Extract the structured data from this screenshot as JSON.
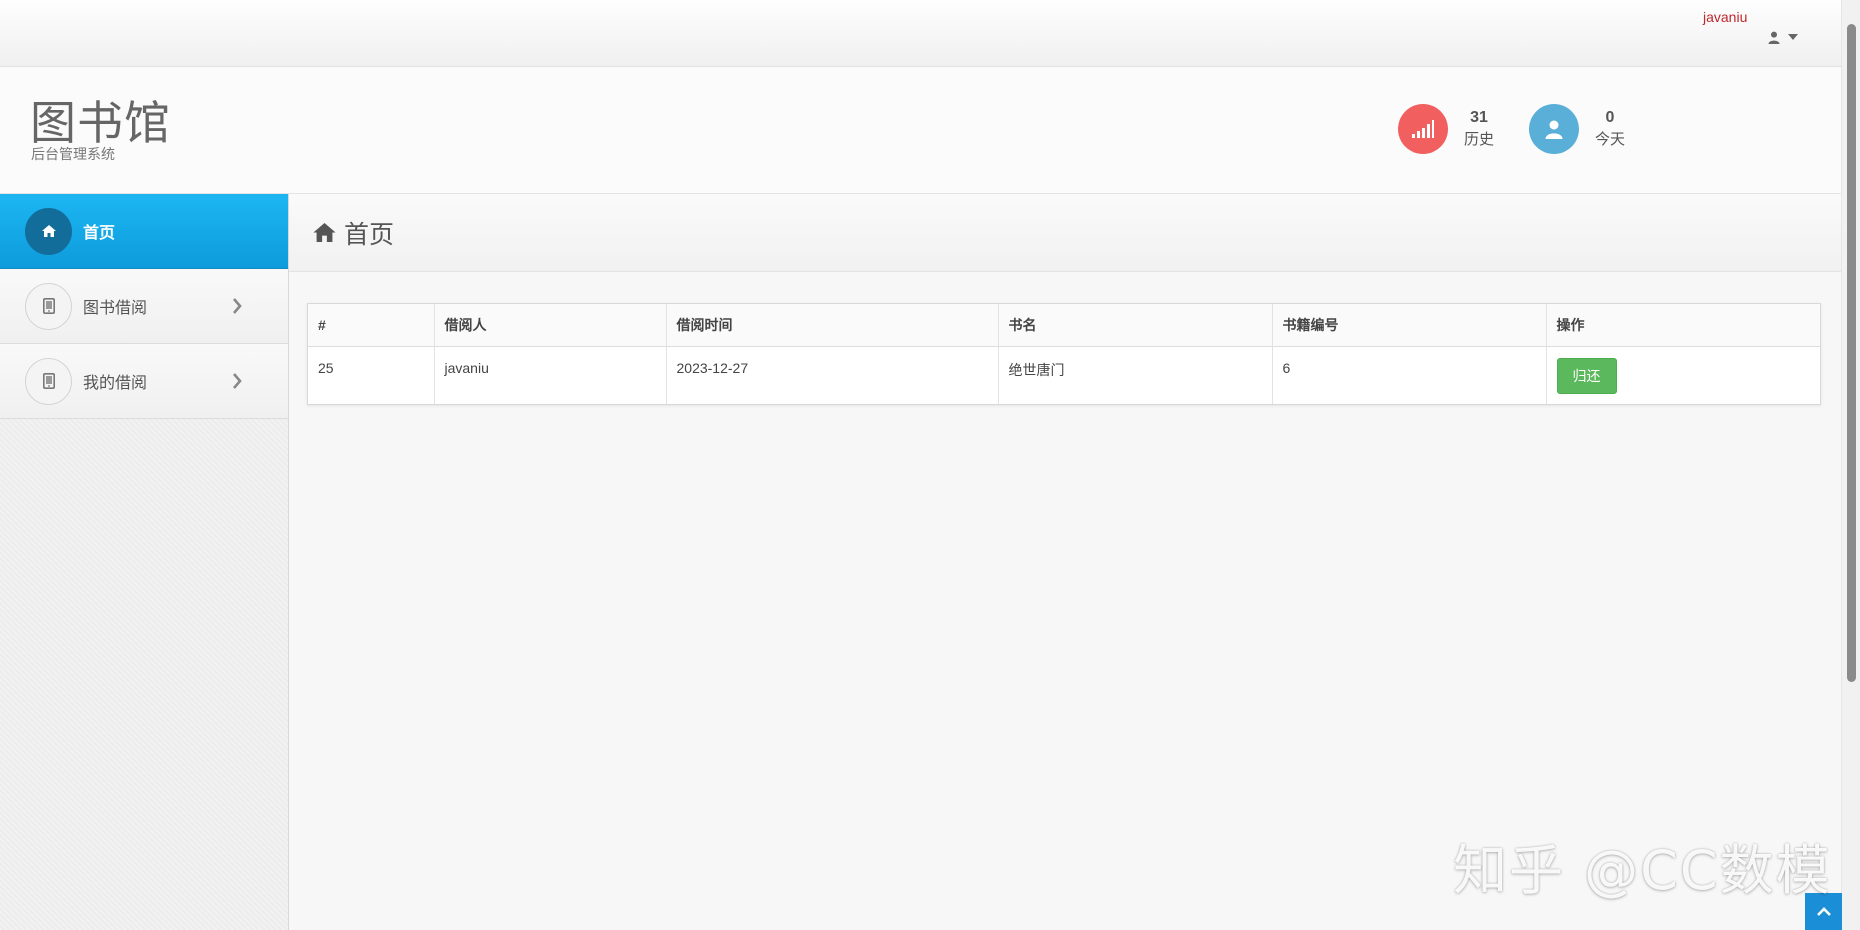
{
  "topbar": {
    "username": "javaniu"
  },
  "header": {
    "title": "图书馆",
    "subtitle": "后台管理系统",
    "stats": [
      {
        "value": "31",
        "label": "历史",
        "color": "#f15f5f",
        "icon": "signal-icon"
      },
      {
        "value": "0",
        "label": "今天",
        "color": "#5aafd9",
        "icon": "user-icon"
      }
    ]
  },
  "sidebar": {
    "active_color": "#14a8ea",
    "items": [
      {
        "label": "首页",
        "icon": "home-icon",
        "active": true
      },
      {
        "label": "图书借阅",
        "icon": "tablet-icon",
        "active": false
      },
      {
        "label": "我的借阅",
        "icon": "tablet-icon",
        "active": false
      }
    ]
  },
  "main": {
    "page_title": "首页",
    "table": {
      "columns": [
        "#",
        "借阅人",
        "借阅时间",
        "书名",
        "书籍编号",
        "操作"
      ],
      "rows": [
        {
          "id": "25",
          "borrower": "javaniu",
          "date": "2023-12-27",
          "book": "绝世唐门",
          "book_no": "6",
          "action": "归还"
        }
      ]
    }
  },
  "watermark": "知乎 @CC数模"
}
